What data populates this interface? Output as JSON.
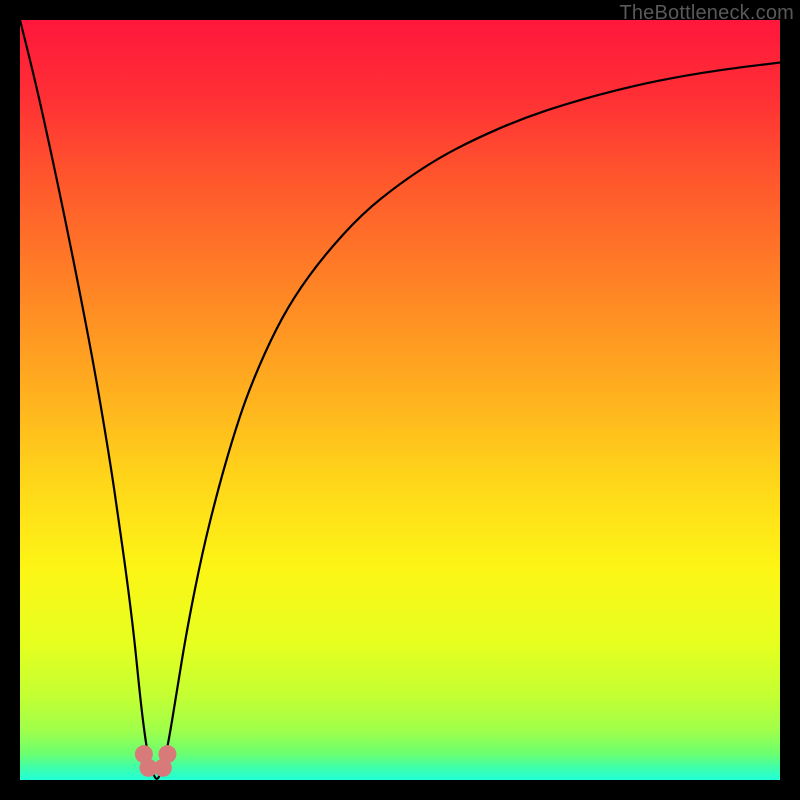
{
  "watermark": "TheBottleneck.com",
  "chart_data": {
    "type": "line",
    "title": "",
    "xlabel": "",
    "ylabel": "",
    "xlim": [
      0,
      100
    ],
    "ylim": [
      0,
      100
    ],
    "grid": false,
    "description": "Bottleneck curve: a sharp V-shaped dip near x≈18 reaching y≈0 with an asymptotic rise toward y≈100 on both sides, overlaid on a vertical rainbow gradient (green at bottom through yellow/orange to red at top).",
    "gradient_stops": [
      {
        "offset": 0.0,
        "color": "#ff173c"
      },
      {
        "offset": 0.1,
        "color": "#ff2f35"
      },
      {
        "offset": 0.22,
        "color": "#ff5a2c"
      },
      {
        "offset": 0.35,
        "color": "#ff8325"
      },
      {
        "offset": 0.48,
        "color": "#ffac1f"
      },
      {
        "offset": 0.6,
        "color": "#ffd41a"
      },
      {
        "offset": 0.72,
        "color": "#fdf516"
      },
      {
        "offset": 0.82,
        "color": "#e6ff1f"
      },
      {
        "offset": 0.89,
        "color": "#c3ff33"
      },
      {
        "offset": 0.935,
        "color": "#9fff4a"
      },
      {
        "offset": 0.965,
        "color": "#6cff6f"
      },
      {
        "offset": 0.985,
        "color": "#3cffae"
      },
      {
        "offset": 1.0,
        "color": "#22ffd8"
      }
    ],
    "curve_min_x": 18,
    "series": [
      {
        "name": "bottleneck-curve",
        "x": [
          0,
          2,
          4,
          6,
          8,
          10,
          12,
          13,
          14,
          15,
          15.8,
          16.4,
          17.0,
          17.6,
          18.0,
          18.4,
          19.0,
          19.8,
          20.6,
          22,
          24,
          26,
          28,
          30,
          33,
          36,
          40,
          45,
          50,
          55,
          60,
          66,
          72,
          80,
          88,
          95,
          100
        ],
        "y": [
          100,
          92,
          83,
          73.5,
          63.5,
          53,
          41,
          34,
          27,
          19,
          11,
          6,
          2.3,
          0.6,
          0,
          0.6,
          2.3,
          6.5,
          11.5,
          20,
          30,
          38,
          45,
          51,
          58,
          63.5,
          69,
          74.5,
          78.5,
          81.8,
          84.4,
          87,
          89,
          91.2,
          92.8,
          93.8,
          94.4
        ]
      }
    ],
    "markers": [
      {
        "x": 16.3,
        "y": 3.4
      },
      {
        "x": 16.9,
        "y": 1.6
      },
      {
        "x": 18.8,
        "y": 1.6
      },
      {
        "x": 19.4,
        "y": 3.4
      }
    ],
    "marker_color": "#d97a7a",
    "marker_radius_px": 9
  }
}
